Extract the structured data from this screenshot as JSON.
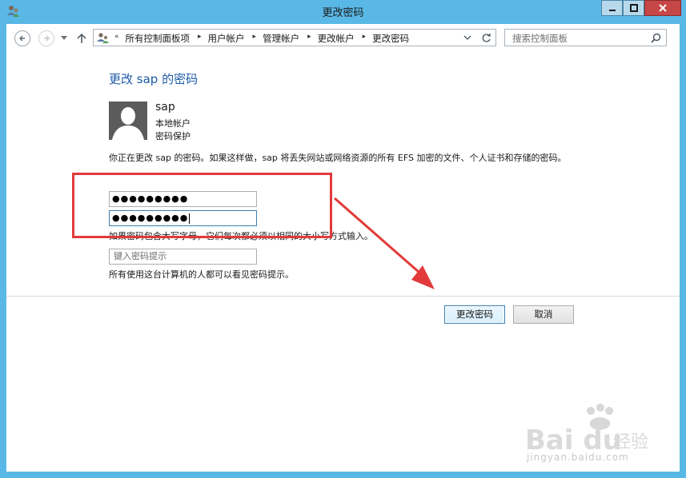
{
  "window": {
    "title": "更改密码"
  },
  "address_bar": {
    "crumbs": [
      "所有控制面板项",
      "用户帐户",
      "管理帐户",
      "更改帐户",
      "更改密码"
    ]
  },
  "search": {
    "placeholder": "搜索控制面板"
  },
  "page": {
    "heading": "更改 sap 的密码",
    "user_name": "sap",
    "user_type": "本地帐户",
    "user_status": "密码保护",
    "description": "你正在更改 sap 的密码。如果这样做，sap 将丢失网站或网络资源的所有 EFS 加密的文件、个人证书和存储的密码。",
    "new_password_value": "●●●●●●●●●",
    "confirm_password_value": "●●●●●●●●●",
    "case_note": "如果密码包含大写字母，它们每次都必须以相同的大小写方式输入。",
    "hint_placeholder": "键入密码提示",
    "hint_note": "所有使用这台计算机的人都可以看见密码提示。"
  },
  "buttons": {
    "change": "更改密码",
    "cancel": "取消"
  },
  "watermark": {
    "logo": "Bai du 经验",
    "url": "jingyan.baidu.com"
  },
  "colors": {
    "titlebar": "#5ab8e6",
    "heading": "#1e5aa8",
    "annotation": "#e23a3a"
  }
}
